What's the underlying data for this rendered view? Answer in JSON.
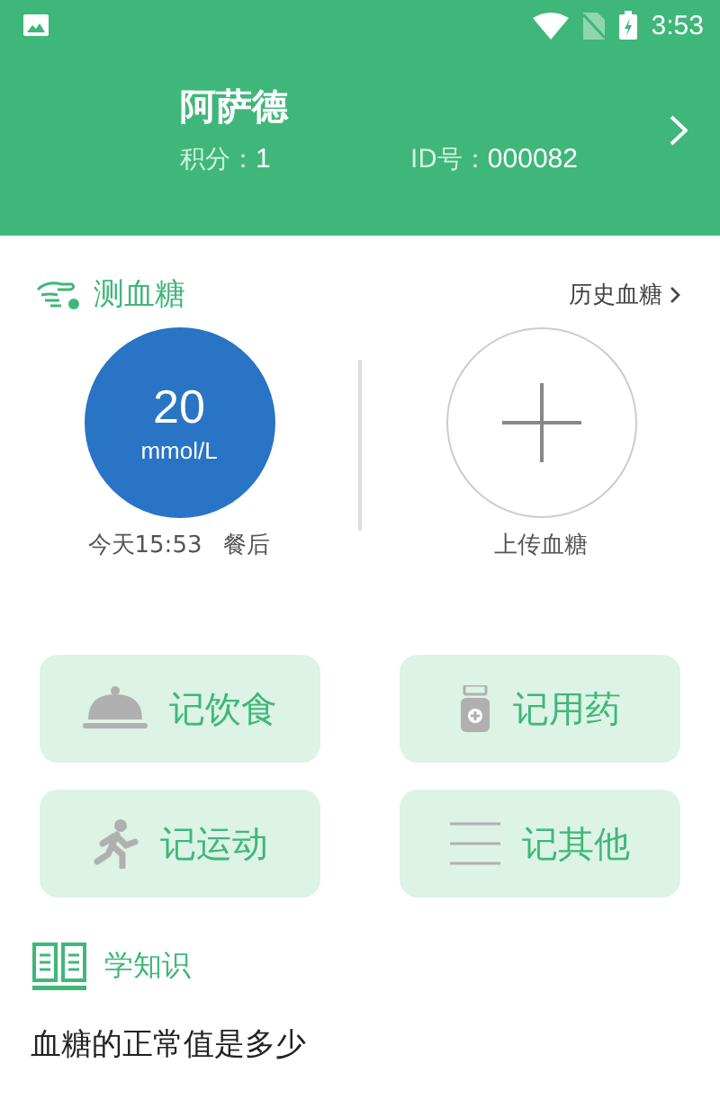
{
  "status_bar": {
    "time": "3:53"
  },
  "profile": {
    "name": "阿萨德",
    "points_label": "积分：",
    "points": "1",
    "id_label": "ID号：",
    "id": "000082"
  },
  "glucose": {
    "title": "测血糖",
    "history_link": "历史血糖",
    "reading": {
      "value": "20",
      "unit": "mmol/L",
      "time": "今天15:53",
      "meal": "餐后"
    },
    "upload_label": "上传血糖"
  },
  "actions": [
    {
      "kind": "food",
      "label": "记饮食"
    },
    {
      "kind": "medicine",
      "label": "记用药"
    },
    {
      "kind": "exercise",
      "label": "记运动"
    },
    {
      "kind": "other",
      "label": "记其他"
    }
  ],
  "knowledge": {
    "title": "学知识",
    "articles": [
      "血糖的正常值是多少"
    ]
  }
}
